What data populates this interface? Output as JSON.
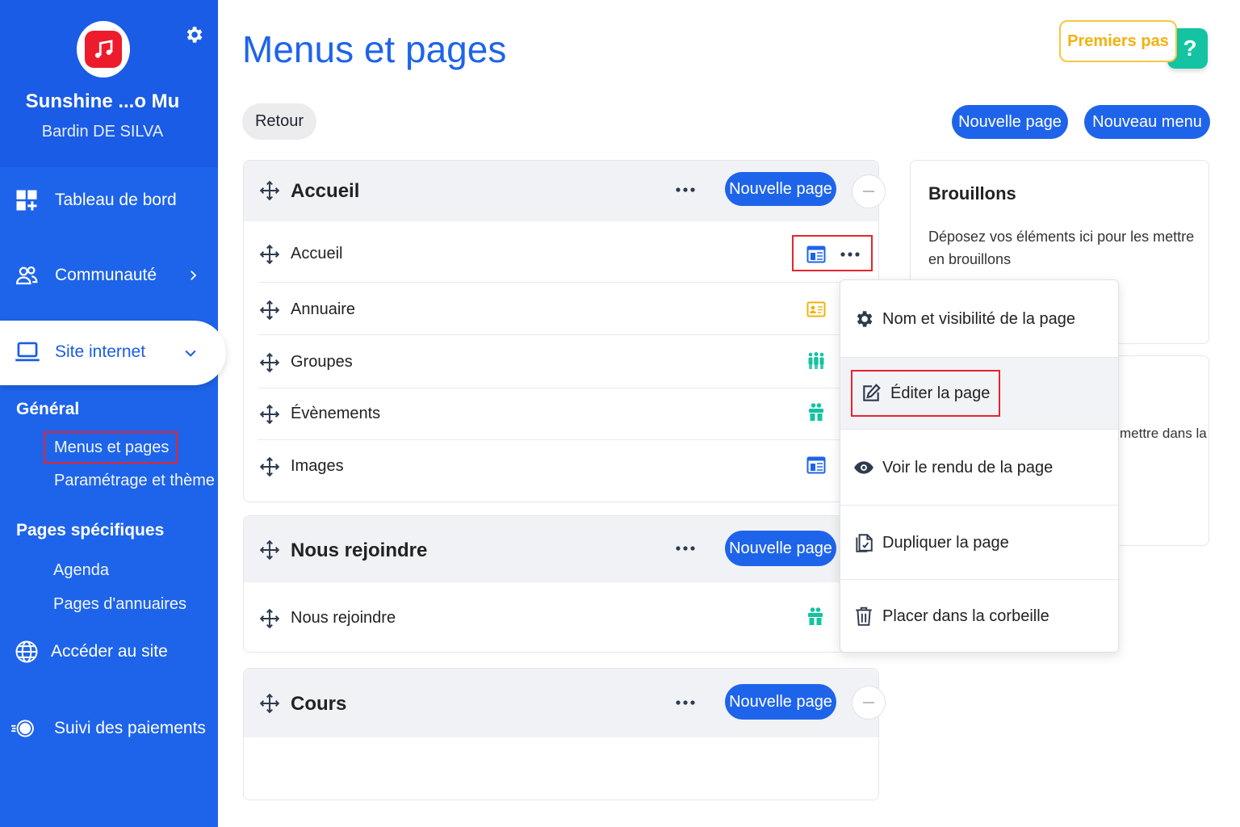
{
  "sidebar": {
    "site_name": "Sunshine ...o Mu",
    "user_name": "Bardin DE SILVA",
    "nav": {
      "dashboard": "Tableau de bord",
      "community": "Communauté",
      "website": "Site internet",
      "general_title": "Général",
      "menus_pages": "Menus et pages",
      "settings_theme": "Paramétrage et thème",
      "specific_title": "Pages spécifiques",
      "agenda": "Agenda",
      "directory_pages": "Pages d'annuaires",
      "visit_site": "Accéder au site",
      "payments": "Suivi des paiements"
    }
  },
  "header": {
    "title": "Menus et pages",
    "premiers_pas": "Premiers pas",
    "help": "?",
    "back": "Retour",
    "new_page": "Nouvelle page",
    "new_menu": "Nouveau menu"
  },
  "menus": [
    {
      "title": "Accueil",
      "new_page": "Nouvelle page",
      "pages": [
        {
          "label": "Accueil",
          "icon": "layout-icon"
        },
        {
          "label": "Annuaire",
          "icon": "contact-card-icon"
        },
        {
          "label": "Groupes",
          "icon": "group-icon"
        },
        {
          "label": "Évènements",
          "icon": "gift-icon"
        },
        {
          "label": "Images",
          "icon": "layout-icon"
        }
      ]
    },
    {
      "title": "Nous rejoindre",
      "new_page": "Nouvelle page",
      "pages": [
        {
          "label": "Nous rejoindre",
          "icon": "gift-icon"
        }
      ]
    },
    {
      "title": "Cours",
      "new_page": "Nouvelle page",
      "pages": []
    }
  ],
  "drafts": {
    "title": "Brouillons",
    "text": "Déposez vos éléments ici pour les mettre en brouillons",
    "trash_partial": "mettre dans la"
  },
  "dropdown": {
    "items": [
      "Nom et visibilité de la page",
      "Éditer la page",
      "Voir le rendu de la page",
      "Dupliquer la page",
      "Placer dans la corbeille"
    ]
  },
  "colors": {
    "primary": "#1e64ea",
    "accent_yellow": "#f2b210",
    "help_teal": "#13c3a1",
    "logo_red": "#ec1c2d",
    "highlight_red": "#e4252f"
  }
}
